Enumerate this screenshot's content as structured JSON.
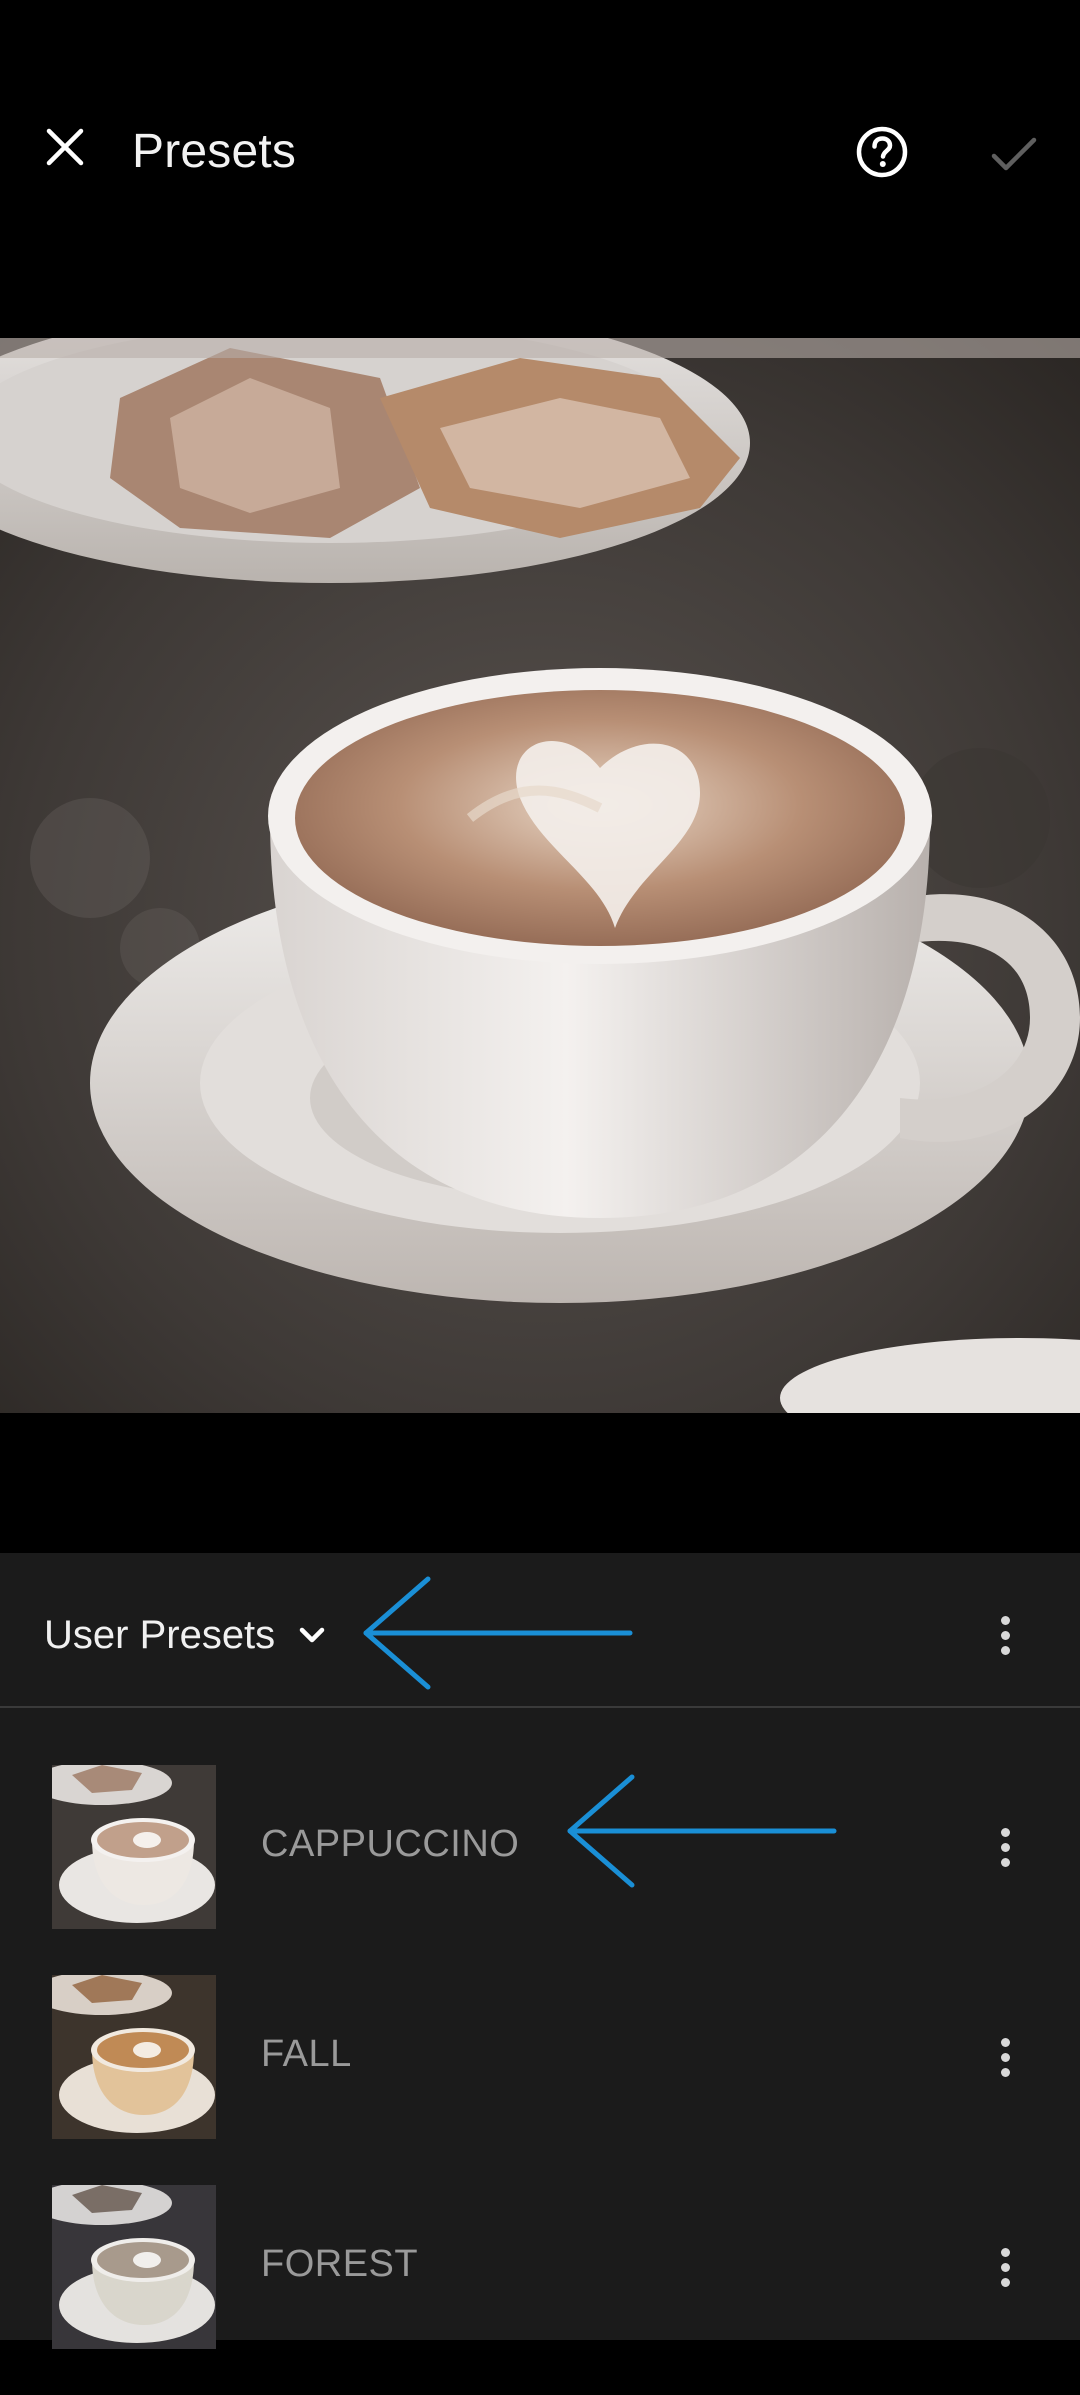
{
  "header": {
    "title": "Presets",
    "close_icon": "close-icon",
    "help_icon": "help-circle-icon",
    "confirm_icon": "checkmark-icon"
  },
  "photo": {
    "subject": "cappuccino-photo"
  },
  "panel": {
    "group_label": "User Presets",
    "group_icon": "chevron-down-icon",
    "menu_icon": "more-vertical-icon",
    "annotation_color": "#1a8fd6"
  },
  "presets": [
    {
      "name": "CAPPUCCINO",
      "tint": "#ede8e3"
    },
    {
      "name": "FALL",
      "tint": "#e2c39a"
    },
    {
      "name": "FOREST",
      "tint": "#d9d6cc"
    }
  ],
  "colors": {
    "background": "#000000",
    "panel": "#1b1b1b",
    "divider": "#3a3a3a",
    "arrow": "#1a8fd6"
  }
}
